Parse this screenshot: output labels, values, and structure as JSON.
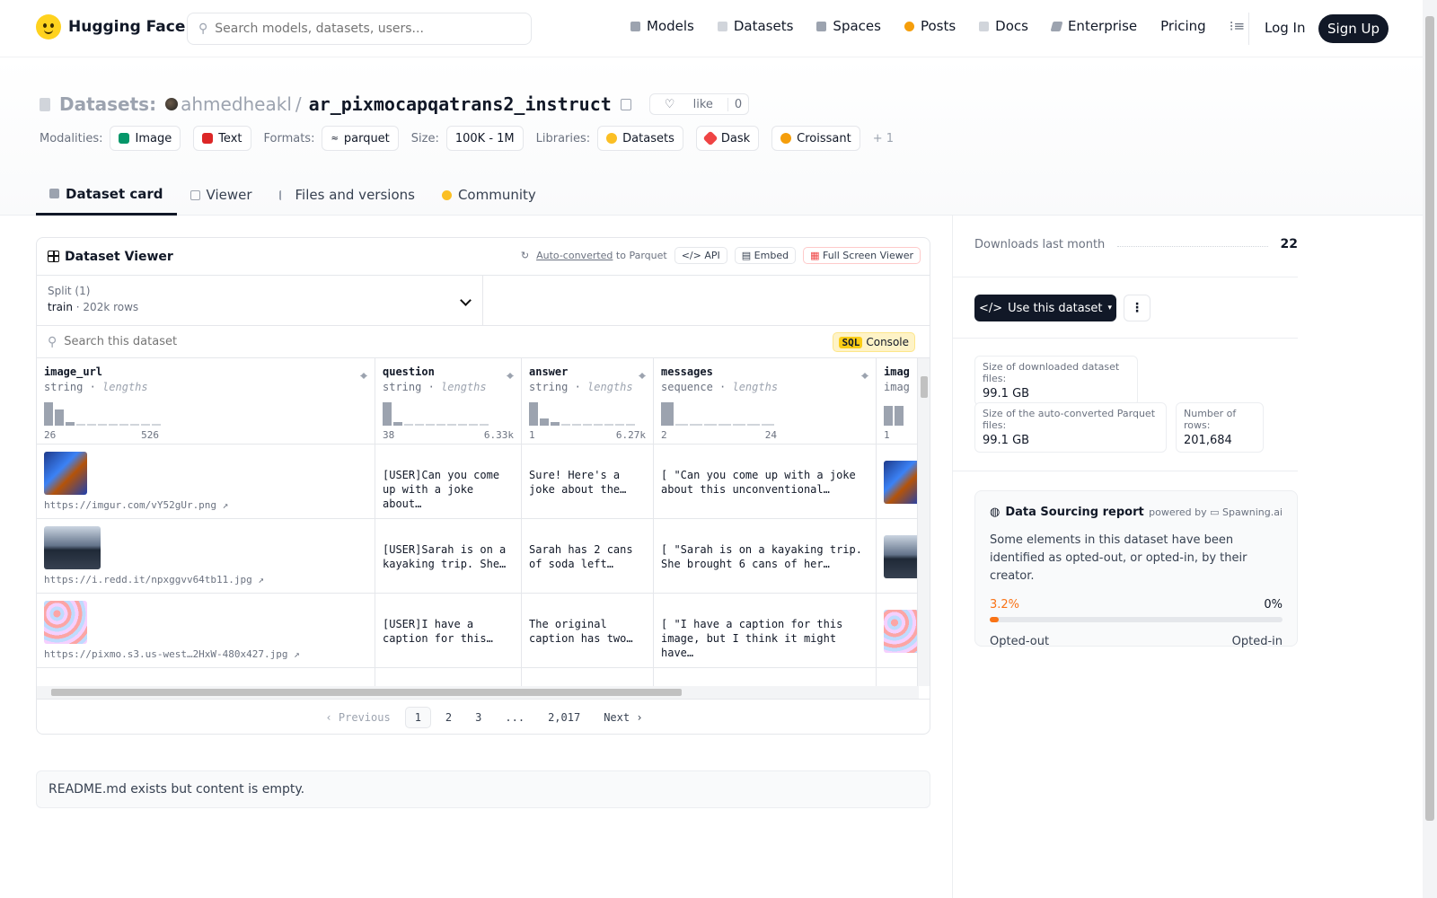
{
  "nav": {
    "brand": "Hugging Face",
    "search_placeholder": "Search models, datasets, users...",
    "links": [
      "Models",
      "Datasets",
      "Spaces",
      "Posts",
      "Docs",
      "Enterprise",
      "Pricing"
    ],
    "login": "Log In",
    "signup": "Sign Up"
  },
  "header": {
    "section": "Datasets:",
    "owner": "ahmedheakl",
    "separator": "/",
    "repo": "ar_pixmocapqatrans2_instruct",
    "like_label": "like",
    "like_count": "0",
    "modalities_label": "Modalities:",
    "modalities": [
      "Image",
      "Text"
    ],
    "formats_label": "Formats:",
    "format": "parquet",
    "size_label": "Size:",
    "size": "100K - 1M",
    "libraries_label": "Libraries:",
    "libraries": [
      "Datasets",
      "Dask",
      "Croissant"
    ],
    "libraries_more": "+ 1"
  },
  "tabs": [
    "Dataset card",
    "Viewer",
    "Files and versions",
    "Community"
  ],
  "viewer": {
    "title": "Dataset Viewer",
    "auto_converted": "Auto-converted",
    "to_parquet": "to Parquet",
    "api": "API",
    "embed": "Embed",
    "full_screen": "Full Screen Viewer",
    "split_label": "Split (1)",
    "split_name": "train",
    "split_rows": "202k rows",
    "search_placeholder": "Search this dataset",
    "sql": "SQL",
    "console": "Console",
    "columns": [
      {
        "name": "image_url",
        "type": "string",
        "stat": "lengths",
        "min": "26",
        "max": "526"
      },
      {
        "name": "question",
        "type": "string",
        "stat": "lengths",
        "min": "38",
        "max": "6.33k"
      },
      {
        "name": "answer",
        "type": "string",
        "stat": "lengths",
        "min": "1",
        "max": "6.27k"
      },
      {
        "name": "messages",
        "type": "sequence",
        "stat": "lengths",
        "min": "2",
        "max": "24"
      },
      {
        "name": "imag",
        "type": "imag",
        "stat": "",
        "min": "1",
        "max": ""
      }
    ],
    "rows": [
      {
        "url": "https://imgur.com/vY52gUr.png ↗",
        "question": "[USER]Can you come up with a joke about…",
        "answer": "Sure! Here's a joke about the…",
        "messages": "[ \"Can you come up with a joke about this unconventional…"
      },
      {
        "url": "https://i.redd.it/npxggvv64tb11.jpg ↗",
        "question": "[USER]Sarah is on a kayaking trip. She…",
        "answer": "Sarah has 2 cans of soda left…",
        "messages": "[ \"Sarah is on a kayaking trip. She brought 6 cans of her…"
      },
      {
        "url": "https://pixmo.s3.us-west…2HxW-480x427.jpg ↗",
        "question": "[USER]I have a caption for this…",
        "answer": "The original caption has two…",
        "messages": "[ \"I have a caption for this image, but I think it might have…"
      }
    ],
    "pager": {
      "prev": "Previous",
      "pages": [
        "1",
        "2",
        "3",
        "...",
        "2,017"
      ],
      "next": "Next"
    }
  },
  "readme": "README.md exists but content is empty.",
  "sidebar": {
    "downloads_label": "Downloads last month",
    "downloads": "22",
    "use_button": "Use this dataset",
    "dl_size_label": "Size of downloaded dataset files:",
    "dl_size": "99.1 GB",
    "parquet_size_label": "Size of the auto-converted Parquet files:",
    "parquet_size": "99.1 GB",
    "rows_label": "Number of rows:",
    "rows": "201,684",
    "report_title": "Data Sourcing report",
    "powered_by": "powered by",
    "powered_name": "Spawning.ai",
    "report_text": "Some elements in this dataset have been identified as opted-out, or opted-in, by their creator.",
    "opt_out_pct": "3.2%",
    "opt_in_pct": "0%",
    "opt_out_value": 0.032,
    "opt_out_label": "Opted-out",
    "opt_in_label": "Opted-in"
  }
}
